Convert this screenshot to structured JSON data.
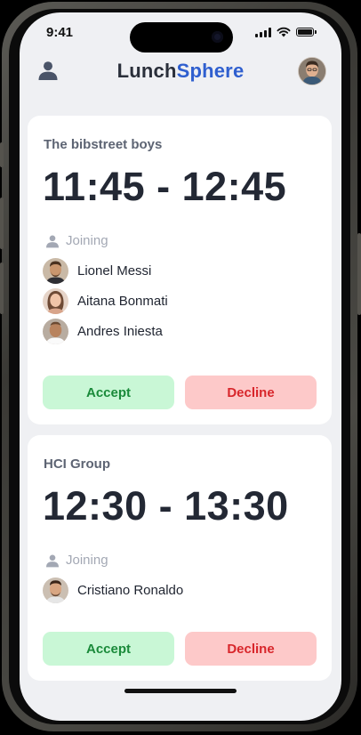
{
  "status_bar": {
    "time": "9:41"
  },
  "app": {
    "title_part1": "Lunch",
    "title_part2": "Sphere",
    "accent_color": "#2f5fcf"
  },
  "cards": [
    {
      "group": "The bibstreet boys",
      "time_range": "11:45 - 12:45",
      "joining_label": "Joining",
      "members": [
        "Lionel Messi",
        "Aitana Bonmati",
        "Andres Iniesta"
      ],
      "accept_label": "Accept",
      "decline_label": "Decline"
    },
    {
      "group": "HCI Group",
      "time_range": "12:30 - 13:30",
      "joining_label": "Joining",
      "members": [
        "Cristiano Ronaldo"
      ],
      "accept_label": "Accept",
      "decline_label": "Decline"
    }
  ],
  "icons": {
    "profile": "person-icon",
    "joining": "person-icon",
    "signal": "cellular-signal-icon",
    "wifi": "wifi-icon",
    "battery": "battery-icon"
  },
  "colors": {
    "accept_bg": "#c9f7d6",
    "accept_text": "#1a8a3a",
    "decline_bg": "#fdc9c9",
    "decline_text": "#d8262b"
  }
}
